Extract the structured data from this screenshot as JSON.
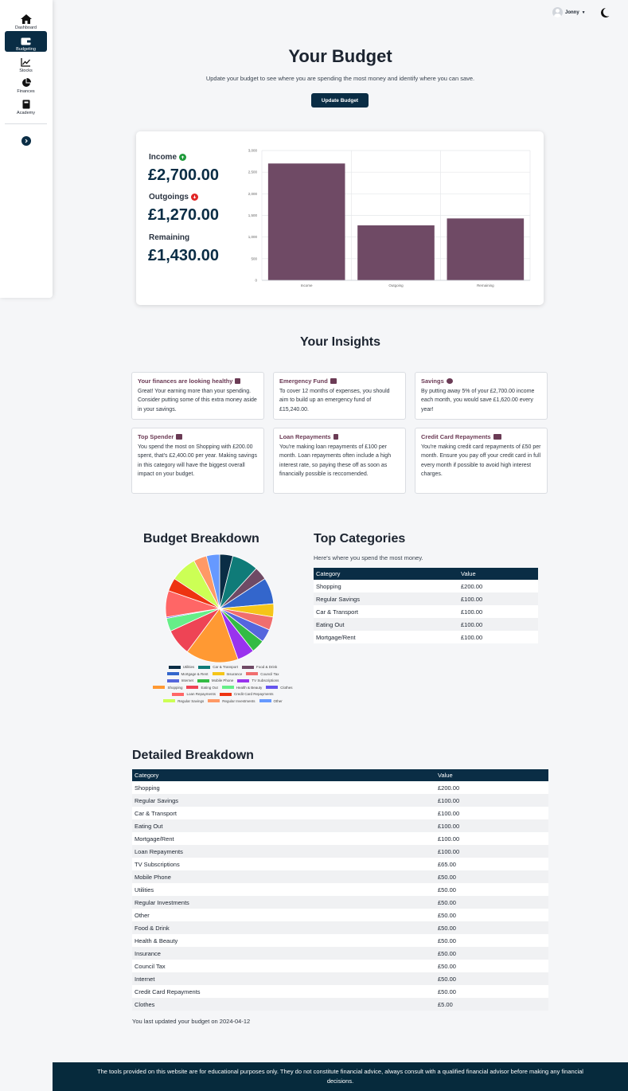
{
  "sidebar": {
    "items": [
      {
        "label": "Dashboard",
        "icon": "home-icon"
      },
      {
        "label": "Budgeting",
        "icon": "wallet-icon"
      },
      {
        "label": "Stocks",
        "icon": "line-chart-icon"
      },
      {
        "label": "Finances",
        "icon": "pie-chart-icon"
      },
      {
        "label": "Academy",
        "icon": "book-icon"
      }
    ],
    "active": "Budgeting"
  },
  "header": {
    "user_name": "Jonny"
  },
  "hero": {
    "title": "Your Budget",
    "subtitle": "Update your budget to see where you are spending the most money and identify where you can save.",
    "update_button": "Update Budget"
  },
  "summary": {
    "income_label": "Income",
    "income_value": "£2,700.00",
    "outgoings_label": "Outgoings",
    "outgoings_value": "£1,270.00",
    "remaining_label": "Remaining",
    "remaining_value": "£1,430.00"
  },
  "chart_data": [
    {
      "type": "bar",
      "categories": [
        "Income",
        "Outgoing",
        "Remaining"
      ],
      "values": [
        2700,
        1270,
        1430
      ],
      "ylim": [
        0,
        3000
      ],
      "yticks": [
        "0",
        "500",
        "1,000",
        "1,500",
        "2,000",
        "2,500",
        "3,000"
      ],
      "grid": true,
      "color": "#6f4a65"
    },
    {
      "type": "pie",
      "title": "Budget Breakdown",
      "labels": [
        "Utilities",
        "Car & Transport",
        "Food & Drink",
        "Mortgage & Rent",
        "Insurance",
        "Council Tax",
        "Internet",
        "Mobile Phone",
        "TV Subscriptions",
        "Shopping",
        "Eating Out",
        "Health & Beauty",
        "Clothes",
        "Loan Repayments",
        "Credit Card Repayments",
        "Regular Savings",
        "Regular Investments",
        "Other"
      ],
      "values": [
        50,
        100,
        50,
        100,
        50,
        50,
        50,
        50,
        65,
        200,
        100,
        50,
        5,
        100,
        50,
        100,
        50,
        50
      ],
      "colors": [
        "#0a2d45",
        "#0f7b78",
        "#6f4a65",
        "#3366cc",
        "#f5c518",
        "#f06e6e",
        "#5566dd",
        "#33bb44",
        "#9933ee",
        "#ff9933",
        "#ee4455",
        "#66ee88",
        "#6655ee",
        "#ff6666",
        "#ee3311",
        "#ccff55",
        "#ff9966",
        "#6699ff"
      ],
      "legend": "bottom"
    }
  ],
  "insights_title": "Your Insights",
  "insights": [
    {
      "title": "Your finances are looking healthy",
      "icon": "thumbs-up-icon",
      "text": "Great! Your earning more than your spending. Consider putting some of this extra money aside in your savings."
    },
    {
      "title": "Emergency Fund",
      "icon": "first-aid-icon",
      "text": "To cover 12 months of expenses, you should aim to build up an emergency fund of £15,240.00."
    },
    {
      "title": "Savings",
      "icon": "piggy-bank-icon",
      "text": "By putting away 5% of your £2,700.00 income each month, you would save £1,620.00 every year!"
    },
    {
      "title": "Top Spender",
      "icon": "money-icon",
      "text": "You spend the most on Shopping with £200.00 spent, that's £2,400.00 per year. Making savings in this category will have the biggest overall impact on your budget."
    },
    {
      "title": "Loan Repayments",
      "icon": "document-icon",
      "text": "You're making loan repayments of £100 per month. Loan repayments often include a high interest rate, so paying these off as soon as financially possible is reccomended."
    },
    {
      "title": "Credit Card Repayments",
      "icon": "credit-card-icon",
      "text": "You're making credit card repayments of £50 per month. Ensure you pay off your credit card in full every month if possible to avoid high interest charges."
    }
  ],
  "top_categories": {
    "title": "Top Categories",
    "subtitle": "Here's where you spend the most money.",
    "headers": [
      "Category",
      "Value"
    ],
    "rows": [
      [
        "Shopping",
        "£200.00"
      ],
      [
        "Regular Savings",
        "£100.00"
      ],
      [
        "Car & Transport",
        "£100.00"
      ],
      [
        "Eating Out",
        "£100.00"
      ],
      [
        "Mortgage/Rent",
        "£100.00"
      ]
    ]
  },
  "detailed": {
    "title": "Detailed Breakdown",
    "headers": [
      "Category",
      "Value"
    ],
    "rows": [
      [
        "Shopping",
        "£200.00"
      ],
      [
        "Regular Savings",
        "£100.00"
      ],
      [
        "Car & Transport",
        "£100.00"
      ],
      [
        "Eating Out",
        "£100.00"
      ],
      [
        "Mortgage/Rent",
        "£100.00"
      ],
      [
        "Loan Repayments",
        "£100.00"
      ],
      [
        "TV Subscriptions",
        "£65.00"
      ],
      [
        "Mobile Phone",
        "£50.00"
      ],
      [
        "Utilities",
        "£50.00"
      ],
      [
        "Regular Investments",
        "£50.00"
      ],
      [
        "Other",
        "£50.00"
      ],
      [
        "Food & Drink",
        "£50.00"
      ],
      [
        "Health & Beauty",
        "£50.00"
      ],
      [
        "Insurance",
        "£50.00"
      ],
      [
        "Council Tax",
        "£50.00"
      ],
      [
        "Internet",
        "£50.00"
      ],
      [
        "Credit Card Repayments",
        "£50.00"
      ],
      [
        "Clothes",
        "£5.00"
      ]
    ],
    "last_updated": "You last updated your budget on 2024-04-12"
  },
  "footer": "The tools provided on this website are for educational purposes only. They do not constitute financial advice, always consult with a qualified financial advisor before making any financial decisions."
}
